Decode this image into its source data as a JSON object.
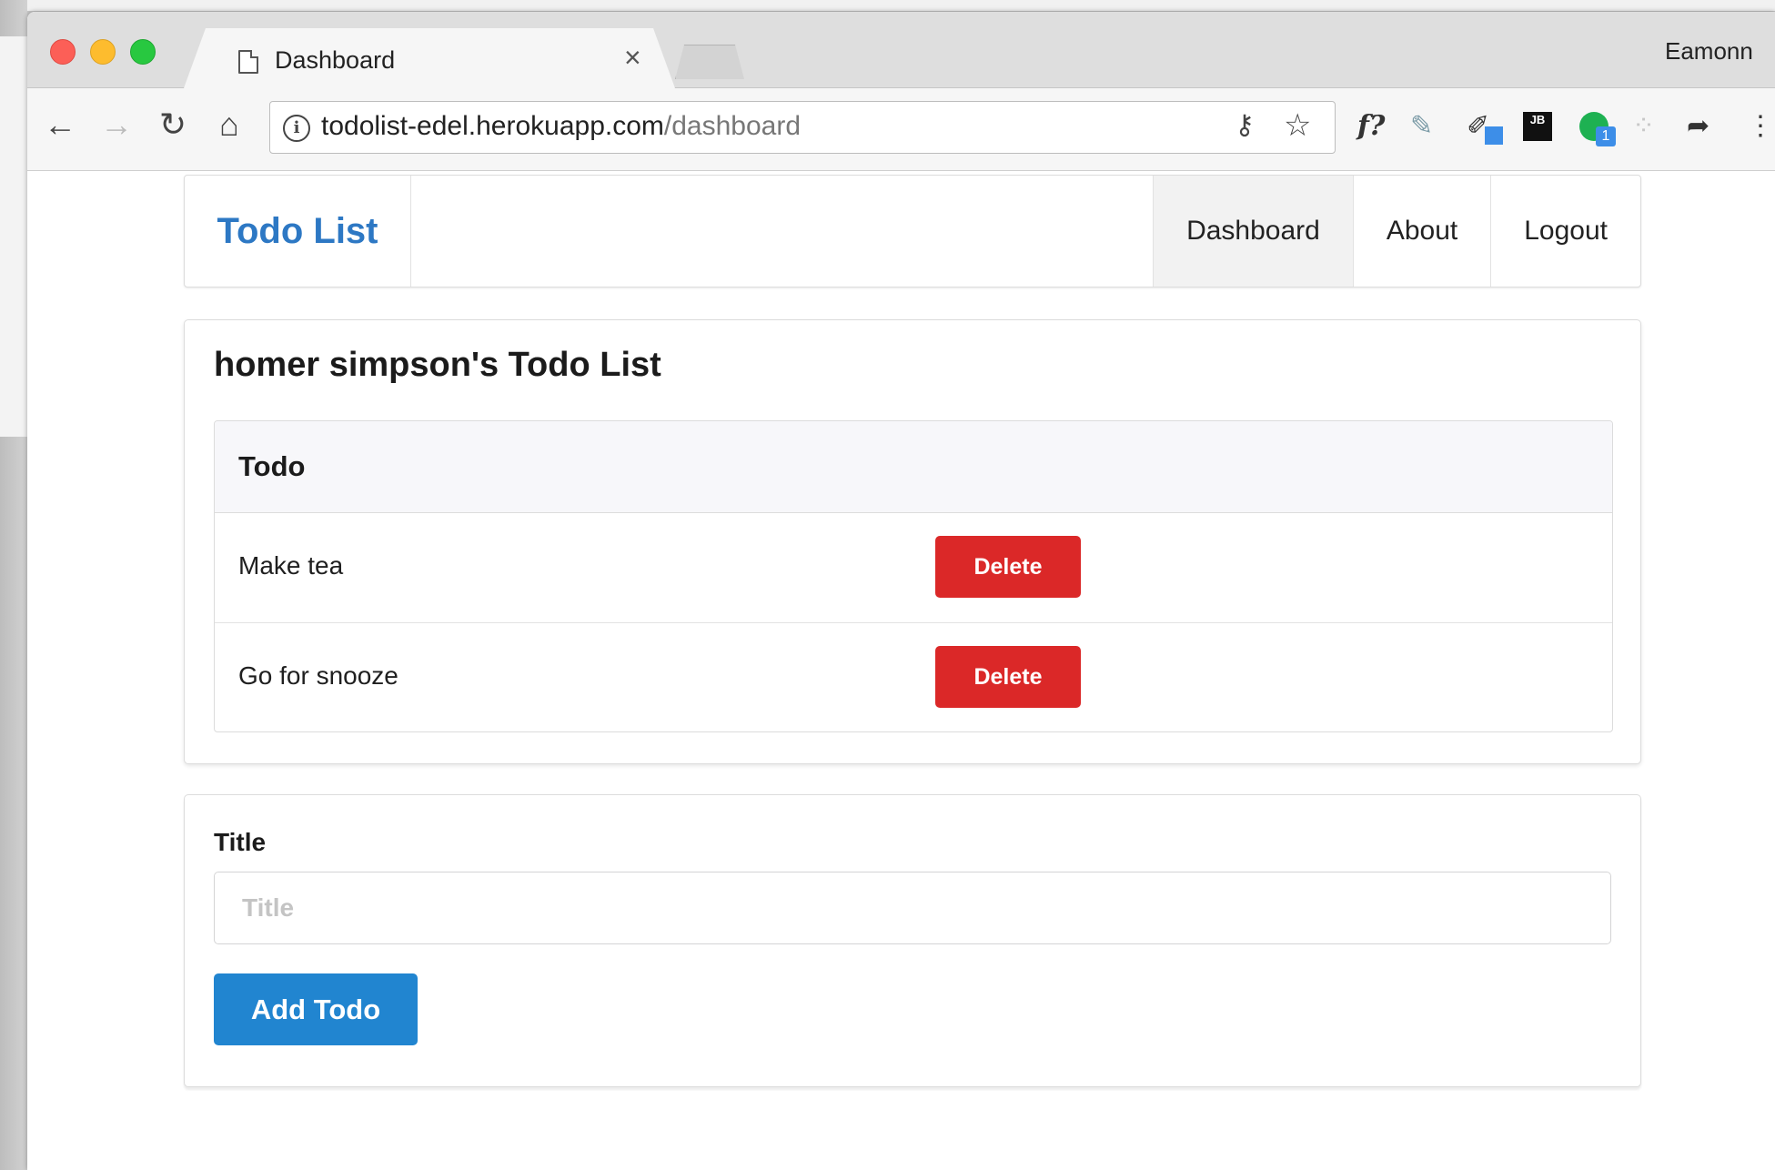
{
  "browser": {
    "tab_title": "Dashboard",
    "tab_close": "×",
    "profile_name": "Eamonn",
    "url_host": "todolist-edel.herokuapp.com",
    "url_path": "/dashboard",
    "extensions": {
      "f_label": "f?",
      "jb_label": "JB",
      "green_badge": "1"
    }
  },
  "navbar": {
    "brand": "Todo List",
    "items": [
      {
        "label": "Dashboard",
        "active": true
      },
      {
        "label": "About",
        "active": false
      },
      {
        "label": "Logout",
        "active": false
      }
    ]
  },
  "todo_list": {
    "heading": "homer simpson's Todo List",
    "column_header": "Todo",
    "rows": [
      {
        "title": "Make tea",
        "action": "Delete"
      },
      {
        "title": "Go for snooze",
        "action": "Delete"
      }
    ]
  },
  "form": {
    "field_label": "Title",
    "placeholder": "Title",
    "value": "",
    "submit_label": "Add Todo"
  },
  "colors": {
    "brand": "#2d78c4",
    "delete_button": "#db2828",
    "primary_button": "#2185d0"
  }
}
